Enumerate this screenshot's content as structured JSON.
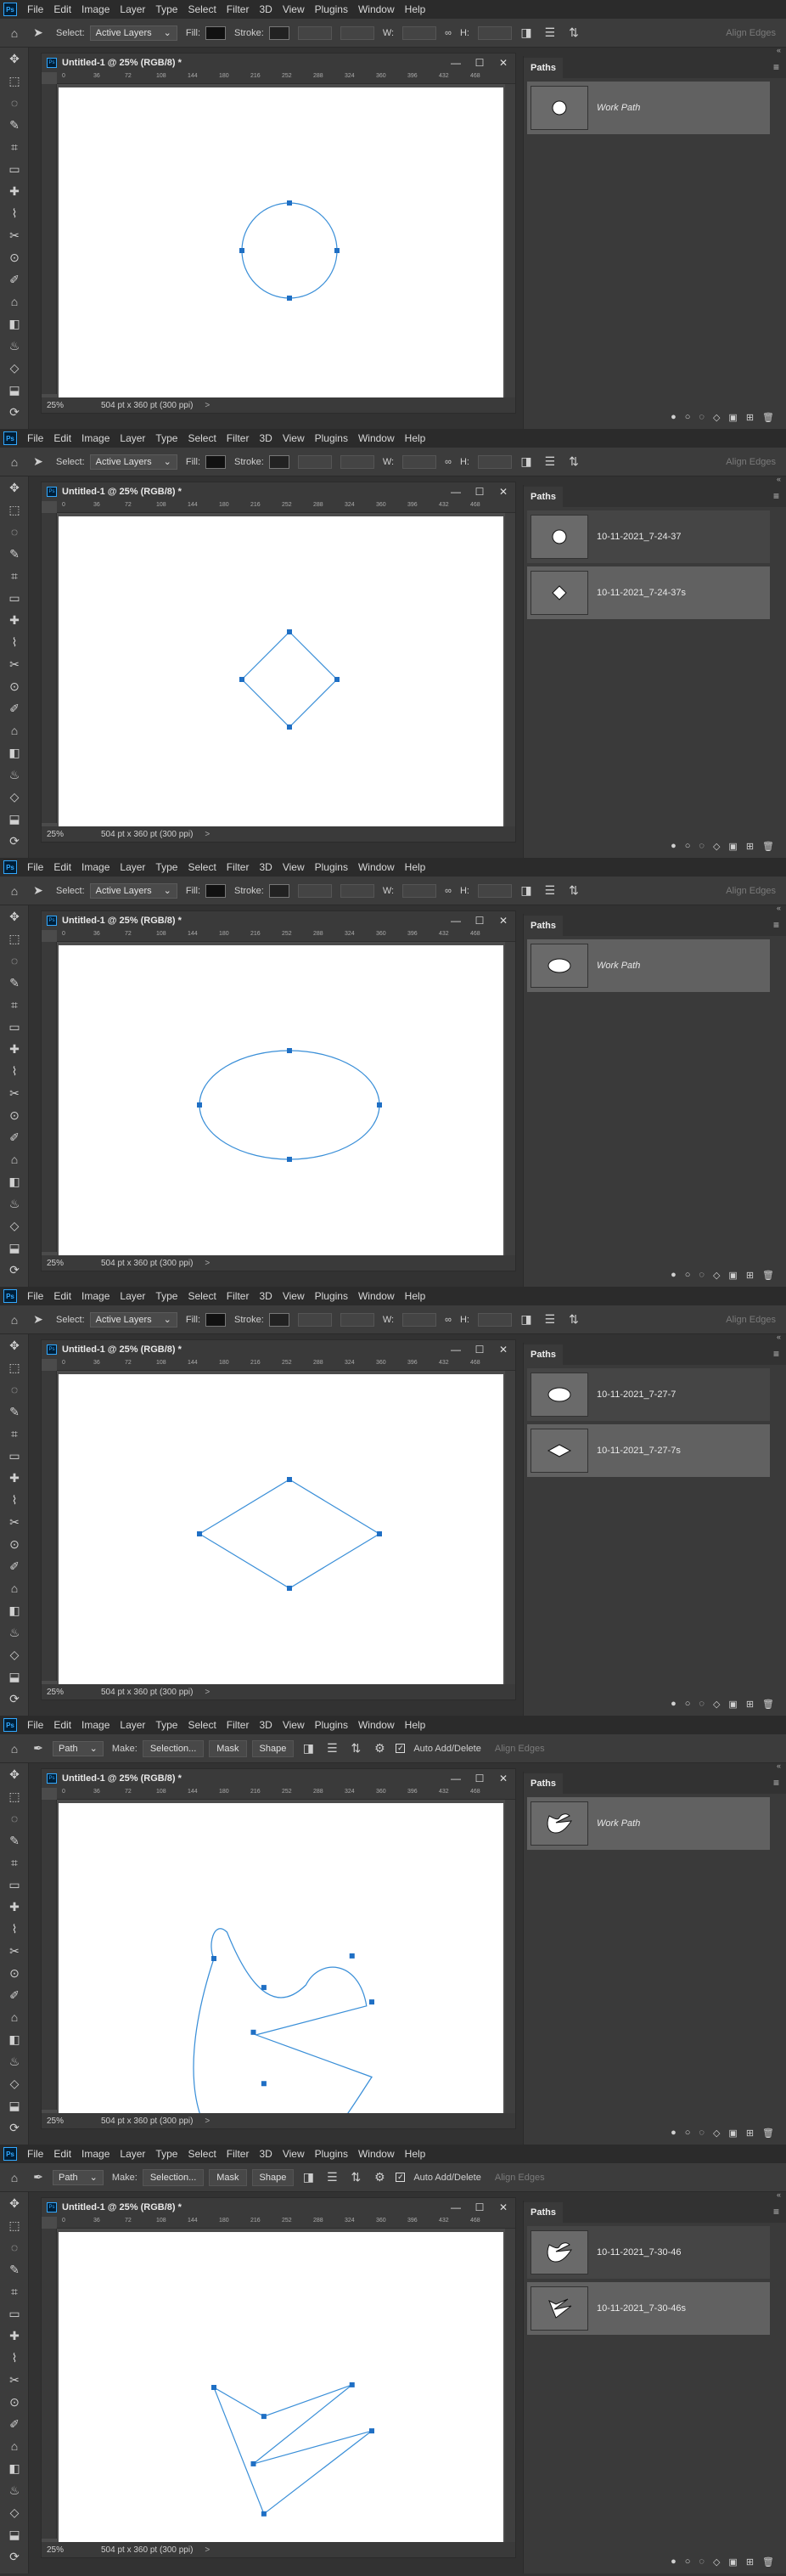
{
  "menu": [
    "File",
    "Edit",
    "Image",
    "Layer",
    "Type",
    "Select",
    "Filter",
    "3D",
    "View",
    "Plugins",
    "Window",
    "Help"
  ],
  "doc_title": "Untitled-1 @ 25% (RGB/8) *",
  "ruler_ticks": [
    "0",
    "36",
    "72",
    "108",
    "144",
    "180",
    "216",
    "252",
    "288",
    "324",
    "360",
    "396",
    "432",
    "468"
  ],
  "status": {
    "zoom": "25%",
    "doc_size": "504 pt x 360 pt (300 ppi)",
    "arrow": ">"
  },
  "panel_title": "Paths",
  "options_select": {
    "select_label": "Select:",
    "select_value": "Active Layers",
    "fill_label": "Fill:",
    "stroke_label": "Stroke:",
    "w_label": "W:",
    "h_label": "H:",
    "align_edges": "Align Edges"
  },
  "options_pen": {
    "mode_value": "Path",
    "make_label": "Make:",
    "selection_btn": "Selection...",
    "mask_btn": "Mask",
    "shape_btn": "Shape",
    "auto_add_delete": "Auto Add/Delete",
    "align_edges": "Align Edges"
  },
  "frames": [
    {
      "paths": [
        {
          "name": "Work Path",
          "italic": true,
          "selected": true,
          "thumb": "circle"
        }
      ]
    },
    {
      "paths": [
        {
          "name": "10-11-2021_7-24-37",
          "italic": false,
          "selected": false,
          "thumb": "circle"
        },
        {
          "name": "10-11-2021_7-24-37s",
          "italic": false,
          "selected": true,
          "thumb": "diamond"
        }
      ]
    },
    {
      "paths": [
        {
          "name": "Work Path",
          "italic": true,
          "selected": true,
          "thumb": "ellipse"
        }
      ]
    },
    {
      "paths": [
        {
          "name": "10-11-2021_7-27-7",
          "italic": false,
          "selected": false,
          "thumb": "ellipse"
        },
        {
          "name": "10-11-2021_7-27-7s",
          "italic": false,
          "selected": true,
          "thumb": "wide-diamond"
        }
      ]
    },
    {
      "paths": [
        {
          "name": "Work Path",
          "italic": true,
          "selected": true,
          "thumb": "blob"
        }
      ]
    },
    {
      "paths": [
        {
          "name": "10-11-2021_7-30-46",
          "italic": false,
          "selected": false,
          "thumb": "blob"
        },
        {
          "name": "10-11-2021_7-30-46s",
          "italic": false,
          "selected": true,
          "thumb": "zigzag"
        }
      ]
    }
  ],
  "colors": {
    "path_stroke": "#3a8fd8",
    "anchor": "#1f6fc4",
    "canvas": "#ffffff",
    "ui_bg": "#323232"
  }
}
